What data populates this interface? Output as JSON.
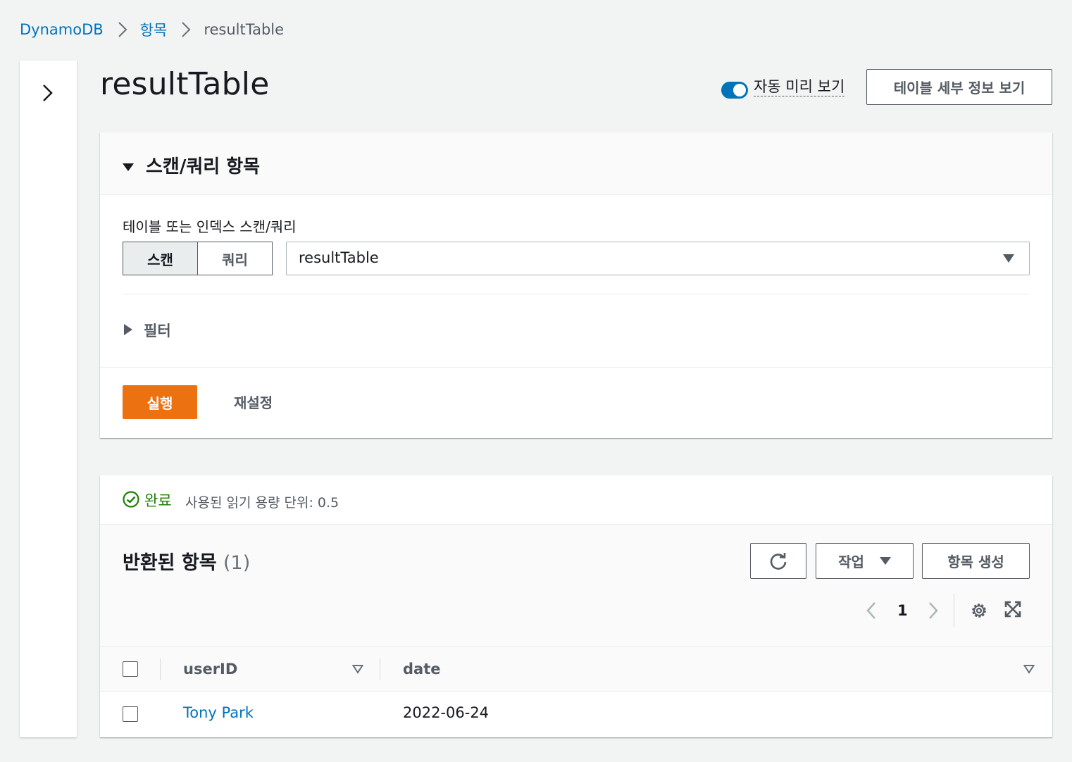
{
  "breadcrumb": {
    "root": "DynamoDB",
    "section": "항목",
    "current": "resultTable"
  },
  "header": {
    "title": "resultTable",
    "auto_preview_label": "자동 미리 보기",
    "auto_preview_on": true,
    "details_button": "테이블 세부 정보 보기"
  },
  "scan_panel": {
    "title": "스캔/쿼리 항목",
    "field_label": "테이블 또는 인덱스 스캔/쿼리",
    "mode_scan": "스캔",
    "mode_query": "쿼리",
    "selected_mode": "스캔",
    "table_select_value": "resultTable",
    "filter_label": "필터",
    "run_button": "실행",
    "reset_button": "재설정"
  },
  "results": {
    "status": "완료",
    "rcu_label": "사용된 읽기 용량 단위: 0.5",
    "title": "반환된 항목",
    "count": "(1)",
    "actions_button": "작업",
    "create_button": "항목 생성",
    "page": "1",
    "columns": [
      "userID",
      "date"
    ],
    "rows": [
      {
        "userID": "Tony Park",
        "date": "2022-06-24"
      }
    ]
  },
  "colors": {
    "link": "#0073bb",
    "primary_button": "#ec7211",
    "success": "#1d8102",
    "toggle_on": "#0073bb"
  }
}
